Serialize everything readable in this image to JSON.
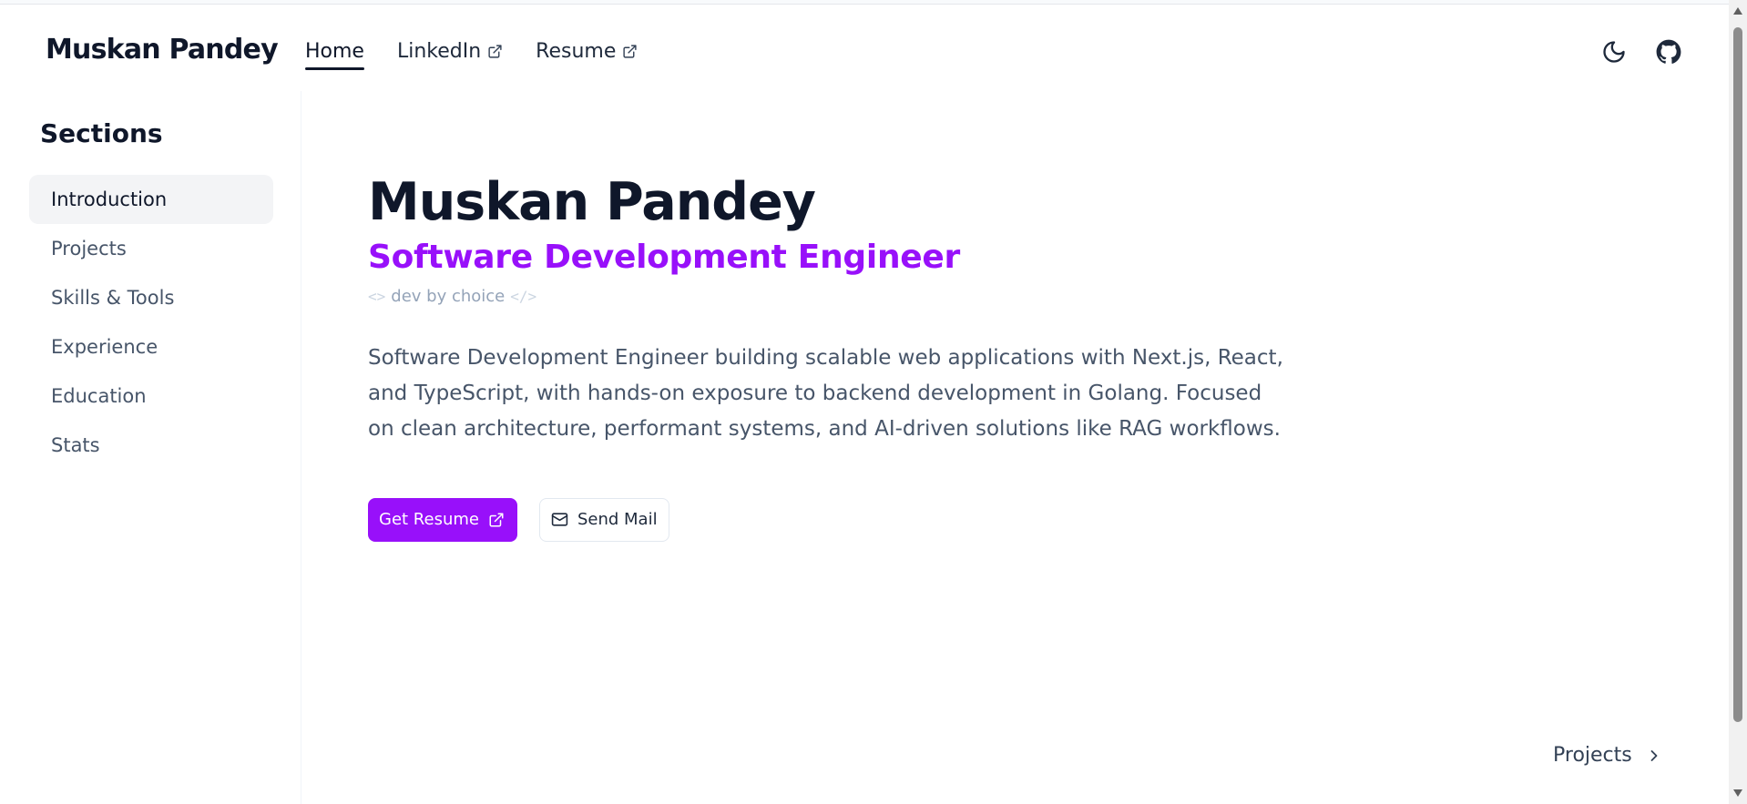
{
  "header": {
    "brand": "Muskan Pandey",
    "nav": [
      {
        "label": "Home",
        "active": true,
        "external": false
      },
      {
        "label": "LinkedIn",
        "active": false,
        "external": true
      },
      {
        "label": "Resume",
        "active": false,
        "external": true
      }
    ],
    "icons": [
      "moon-icon",
      "github-icon"
    ]
  },
  "sidebar": {
    "title": "Sections",
    "items": [
      {
        "label": "Introduction",
        "active": true
      },
      {
        "label": "Projects",
        "active": false
      },
      {
        "label": "Skills & Tools",
        "active": false
      },
      {
        "label": "Experience",
        "active": false
      },
      {
        "label": "Education",
        "active": false
      },
      {
        "label": "Stats",
        "active": false
      }
    ]
  },
  "hero": {
    "name": "Muskan Pandey",
    "role": "Software Development Engineer",
    "tagline_open": "<>",
    "tagline": "dev by choice",
    "tagline_close": "</>",
    "bio": "Software Development Engineer building scalable web applications with Next.js, React, and TypeScript, with hands-on exposure to backend development in Golang. Focused on clean architecture, performant systems, and AI-driven solutions like RAG workflows.",
    "primary_button": "Get Resume",
    "secondary_button": "Send Mail"
  },
  "next": {
    "label": "Projects"
  },
  "colors": {
    "accent": "#9810fa",
    "text": "#0f172a",
    "muted": "#475569"
  }
}
